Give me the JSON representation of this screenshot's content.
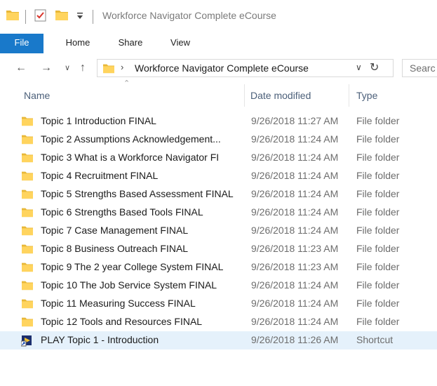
{
  "window": {
    "title": "Workforce Navigator Complete eCourse"
  },
  "ribbon": {
    "tabs": [
      "File",
      "Home",
      "Share",
      "View"
    ]
  },
  "address": {
    "path": "Workforce Navigator Complete eCourse",
    "search_placeholder": "Searc"
  },
  "columns": {
    "name": "Name",
    "date": "Date modified",
    "type": "Type"
  },
  "files": [
    {
      "name": "Topic 1 Introduction FINAL",
      "date": "9/26/2018 11:27 AM",
      "type": "File folder",
      "icon": "folder-icon"
    },
    {
      "name": "Topic 2 Assumptions Acknowledgement...",
      "date": "9/26/2018 11:24 AM",
      "type": "File folder",
      "icon": "folder-icon"
    },
    {
      "name": "Topic 3 What is a Workforce Navigator FI",
      "date": "9/26/2018 11:24 AM",
      "type": "File folder",
      "icon": "folder-icon"
    },
    {
      "name": "Topic 4 Recruitment FINAL",
      "date": "9/26/2018 11:24 AM",
      "type": "File folder",
      "icon": "folder-icon"
    },
    {
      "name": "Topic 5 Strengths Based Assessment FINAL",
      "date": "9/26/2018 11:24 AM",
      "type": "File folder",
      "icon": "folder-icon"
    },
    {
      "name": "Topic 6 Strengths Based Tools FINAL",
      "date": "9/26/2018 11:24 AM",
      "type": "File folder",
      "icon": "folder-icon"
    },
    {
      "name": "Topic 7 Case Management FINAL",
      "date": "9/26/2018 11:24 AM",
      "type": "File folder",
      "icon": "folder-icon"
    },
    {
      "name": "Topic 8 Business Outreach FINAL",
      "date": "9/26/2018 11:23 AM",
      "type": "File folder",
      "icon": "folder-icon"
    },
    {
      "name": "Topic 9 The 2 year College System FINAL",
      "date": "9/26/2018 11:23 AM",
      "type": "File folder",
      "icon": "folder-icon"
    },
    {
      "name": "Topic 10 The Job Service System FINAL",
      "date": "9/26/2018 11:24 AM",
      "type": "File folder",
      "icon": "folder-icon"
    },
    {
      "name": "Topic 11 Measuring Success FINAL",
      "date": "9/26/2018 11:24 AM",
      "type": "File folder",
      "icon": "folder-icon"
    },
    {
      "name": "Topic 12 Tools and Resources FINAL",
      "date": "9/26/2018 11:24 AM",
      "type": "File folder",
      "icon": "folder-icon"
    },
    {
      "name": "PLAY Topic 1 - Introduction",
      "date": "9/26/2018 11:26 AM",
      "type": "Shortcut",
      "icon": "media-shortcut-icon",
      "selected": true
    }
  ],
  "colors": {
    "file_tab": "#1979ca",
    "folder": "#ffd45e",
    "selection": "#e5f1fb",
    "header_text": "#4c607a"
  }
}
